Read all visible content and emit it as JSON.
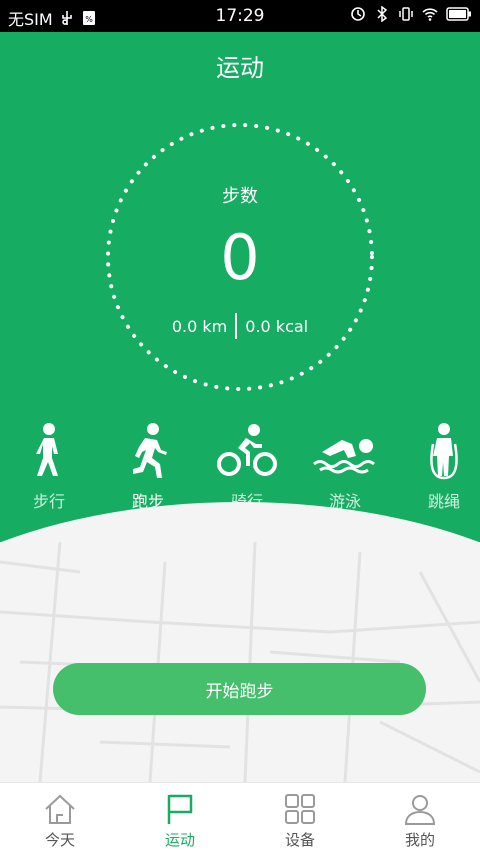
{
  "status_bar": {
    "carrier": "无SIM",
    "time": "17:29",
    "icons": [
      "usb-icon",
      "notification-icon",
      "alarm-icon",
      "bluetooth-icon",
      "vibrate-icon",
      "wifi-icon",
      "battery-icon"
    ]
  },
  "header": {
    "title": "运动"
  },
  "ring": {
    "label": "步数",
    "steps": "0",
    "distance": "0.0 km",
    "calories": "0.0 kcal"
  },
  "sports": [
    {
      "label": "步行",
      "icon": "walking-icon",
      "active": false
    },
    {
      "label": "跑步",
      "icon": "running-icon",
      "active": true
    },
    {
      "label": "骑行",
      "icon": "cycling-icon",
      "active": false
    },
    {
      "label": "游泳",
      "icon": "swimming-icon",
      "active": false
    },
    {
      "label": "跳绳",
      "icon": "jump-rope-icon",
      "active": false
    }
  ],
  "start_button": {
    "label": "开始跑步"
  },
  "bottom_nav": [
    {
      "label": "今天",
      "icon": "home-icon",
      "active": false
    },
    {
      "label": "运动",
      "icon": "flag-icon",
      "active": true
    },
    {
      "label": "设备",
      "icon": "grid-icon",
      "active": false
    },
    {
      "label": "我的",
      "icon": "user-icon",
      "active": false
    }
  ],
  "colors": {
    "primary": "#16ad63",
    "button": "#45bf6c",
    "background": "#f4f4f4"
  }
}
